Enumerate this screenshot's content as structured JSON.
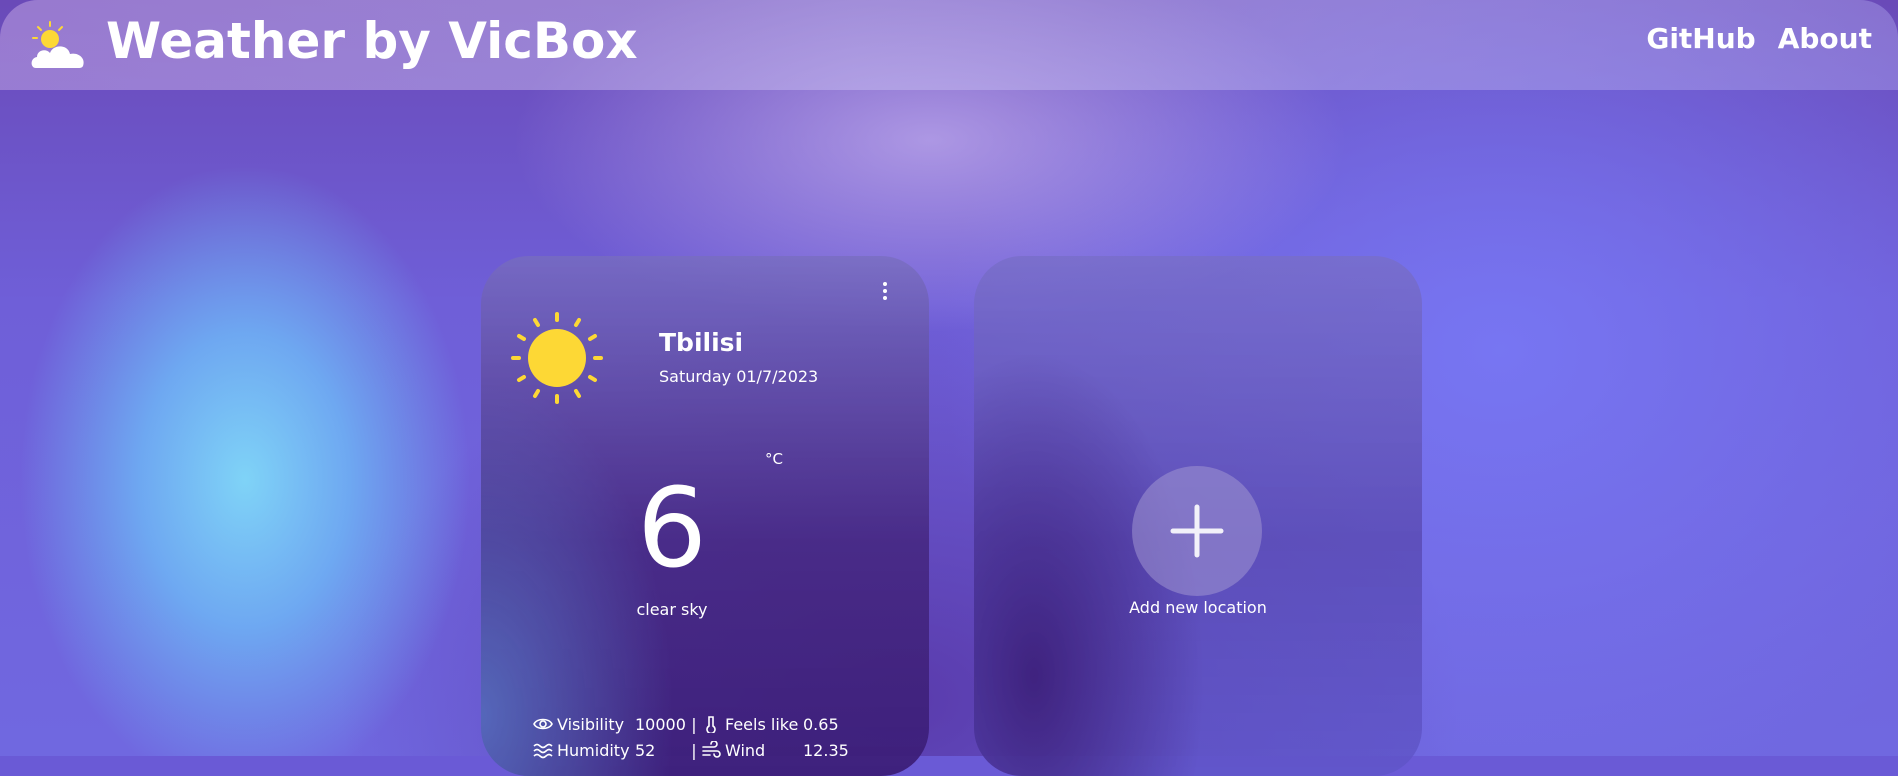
{
  "app": {
    "title": "Weather by VicBox"
  },
  "nav": {
    "github": "GitHub",
    "about": "About"
  },
  "weather_card": {
    "city": "Tbilisi",
    "date": "Saturday 01/7/2023",
    "temperature": "6",
    "unit": "°C",
    "description": "clear sky",
    "icon": "sun-icon",
    "stats": {
      "visibility_label": "Visibility",
      "visibility_value": "10000",
      "feels_like_label": "Feels like",
      "feels_like_value": "0.65",
      "humidity_label": "Humidity",
      "humidity_value": "52",
      "wind_label": "Wind",
      "wind_value": "12.35",
      "separator": "|"
    }
  },
  "add_card": {
    "label": "Add new location"
  },
  "colors": {
    "sun": "#fdd835",
    "text": "#ffffff"
  }
}
